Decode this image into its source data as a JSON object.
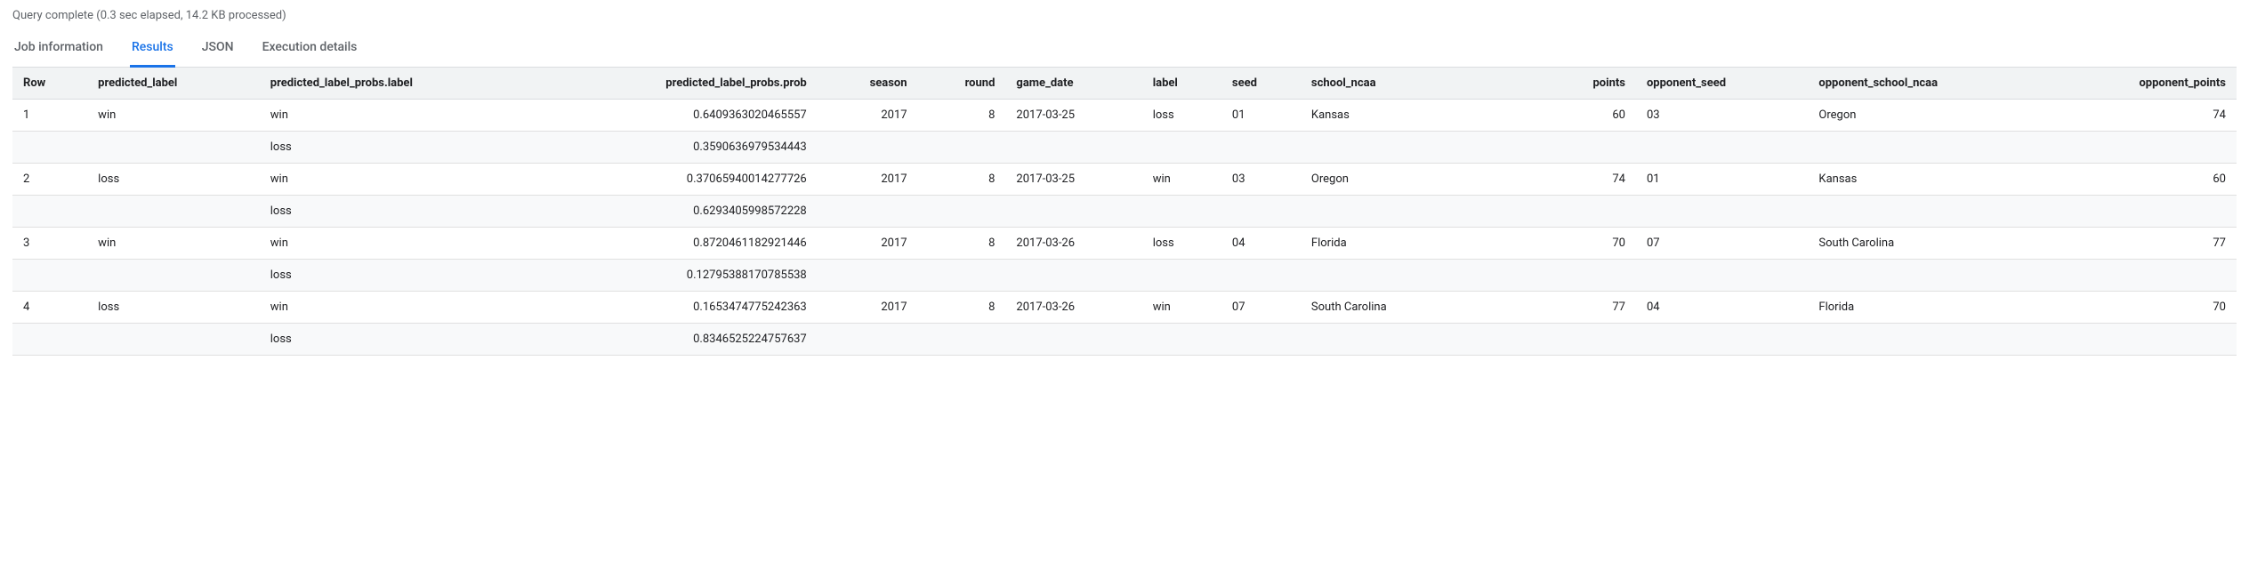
{
  "status": "Query complete (0.3 sec elapsed, 14.2 KB processed)",
  "tabs": {
    "job_info": "Job information",
    "results": "Results",
    "json": "JSON",
    "execution": "Execution details"
  },
  "columns": {
    "row": "Row",
    "predicted_label": "predicted_label",
    "predicted_label_probs_label": "predicted_label_probs.label",
    "predicted_label_probs_prob": "predicted_label_probs.prob",
    "season": "season",
    "round": "round",
    "game_date": "game_date",
    "label": "label",
    "seed": "seed",
    "school_ncaa": "school_ncaa",
    "points": "points",
    "opponent_seed": "opponent_seed",
    "opponent_school_ncaa": "opponent_school_ncaa",
    "opponent_points": "opponent_points"
  },
  "rows": [
    {
      "row": "1",
      "predicted_label": "win",
      "probs": [
        {
          "label": "win",
          "prob": "0.6409363020465557"
        },
        {
          "label": "loss",
          "prob": "0.3590636979534443"
        }
      ],
      "season": "2017",
      "round": "8",
      "game_date": "2017-03-25",
      "label": "loss",
      "seed": "01",
      "school_ncaa": "Kansas",
      "points": "60",
      "opponent_seed": "03",
      "opponent_school_ncaa": "Oregon",
      "opponent_points": "74"
    },
    {
      "row": "2",
      "predicted_label": "loss",
      "probs": [
        {
          "label": "win",
          "prob": "0.37065940014277726"
        },
        {
          "label": "loss",
          "prob": "0.6293405998572228"
        }
      ],
      "season": "2017",
      "round": "8",
      "game_date": "2017-03-25",
      "label": "win",
      "seed": "03",
      "school_ncaa": "Oregon",
      "points": "74",
      "opponent_seed": "01",
      "opponent_school_ncaa": "Kansas",
      "opponent_points": "60"
    },
    {
      "row": "3",
      "predicted_label": "win",
      "probs": [
        {
          "label": "win",
          "prob": "0.8720461182921446"
        },
        {
          "label": "loss",
          "prob": "0.12795388170785538"
        }
      ],
      "season": "2017",
      "round": "8",
      "game_date": "2017-03-26",
      "label": "loss",
      "seed": "04",
      "school_ncaa": "Florida",
      "points": "70",
      "opponent_seed": "07",
      "opponent_school_ncaa": "South Carolina",
      "opponent_points": "77"
    },
    {
      "row": "4",
      "predicted_label": "loss",
      "probs": [
        {
          "label": "win",
          "prob": "0.1653474775242363"
        },
        {
          "label": "loss",
          "prob": "0.8346525224757637"
        }
      ],
      "season": "2017",
      "round": "8",
      "game_date": "2017-03-26",
      "label": "win",
      "seed": "07",
      "school_ncaa": "South Carolina",
      "points": "77",
      "opponent_seed": "04",
      "opponent_school_ncaa": "Florida",
      "opponent_points": "70"
    }
  ]
}
